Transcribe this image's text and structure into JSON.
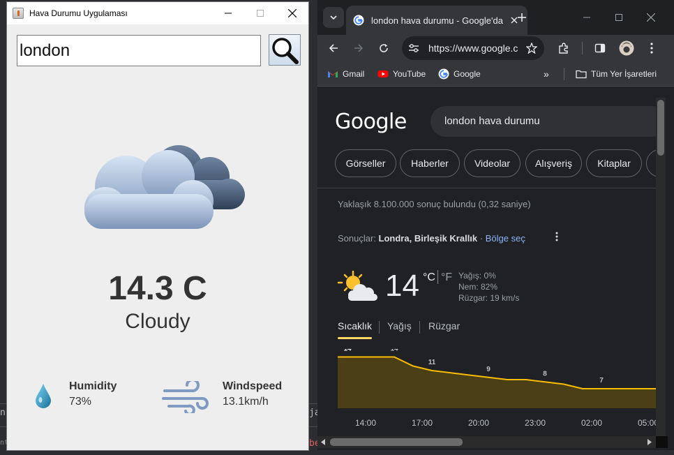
{
  "swing_app": {
    "title": "Hava Durumu Uygulaması",
    "search_value": "london",
    "weather_icon": "cloudy-icon",
    "temperature": "14.3 C",
    "condition": "Cloudy",
    "humidity_label": "Humidity",
    "humidity_value": "73%",
    "windspeed_label": "Windspeed",
    "windspeed_value": "13.1km/h"
  },
  "chrome": {
    "tab_title": "london hava durumu - Google'da Ara",
    "url": "https://www.google.com/search?q=london+hava+durumu",
    "bookmarks": [
      "Gmail",
      "YouTube",
      "Google"
    ],
    "all_bookmarks": "Tüm Yer İşaretleri",
    "google_logo": "Google",
    "search_query": "london hava durumu",
    "chips": [
      "Görseller",
      "Haberler",
      "Videolar",
      "Alışveriş",
      "Kitaplar"
    ],
    "result_stats": "Yaklaşık 8.100.000 sonuç bulundu (0,32 saniye)",
    "results_for_prefix": "Sonuçlar:",
    "results_for_location": "Londra, Birleşik Krallık",
    "results_for_sep": "·",
    "choose_region": "Bölge seç",
    "weather": {
      "temp": "14",
      "unit_c": "°C",
      "unit_f": "°F",
      "precip": "Yağış: 0%",
      "humidity": "Nem: 82%",
      "wind": "Rüzgar: 19 km/s",
      "tabs": [
        "Sıcaklık",
        "Yağış",
        "Rüzgar"
      ],
      "icon": "partly-cloudy-icon"
    }
  },
  "chart_data": {
    "type": "area",
    "x": [
      "14:00",
      "15:00",
      "16:00",
      "17:00",
      "18:00",
      "19:00",
      "20:00",
      "21:00",
      "22:00",
      "23:00",
      "00:00",
      "01:00",
      "02:00",
      "03:00",
      "04:00",
      "05:00"
    ],
    "values": [
      14,
      14,
      14,
      14,
      12,
      11,
      10.5,
      10,
      9.5,
      9,
      9,
      8.5,
      8,
      7,
      7,
      7
    ],
    "data_labels": [
      [
        "14:00",
        "14"
      ],
      [
        "17:00",
        "14"
      ],
      [
        "19:00",
        "11"
      ],
      [
        "22:00",
        "9"
      ],
      [
        "01:00",
        "8"
      ],
      [
        "04:00",
        "7"
      ]
    ],
    "tick_labels": [
      "14:00",
      "17:00",
      "20:00",
      "23:00",
      "02:00",
      "05:00"
    ],
    "ylim": [
      0,
      16
    ],
    "colors": {
      "line": "#fbbc04",
      "fill": "#4a3f16"
    }
  },
  "background": {
    "fragments": [
      "ns",
      "ja",
      "t(",
      "nt",
      "be"
    ]
  }
}
